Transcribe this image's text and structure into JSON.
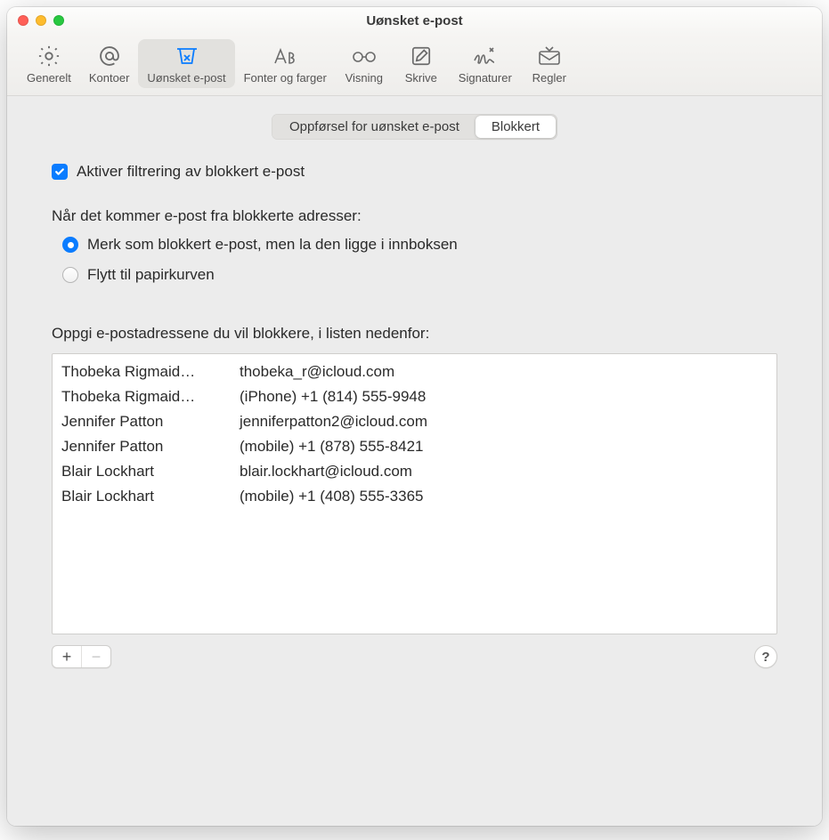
{
  "window": {
    "title": "Uønsket e-post"
  },
  "toolbar": {
    "items": [
      {
        "label": "Generelt"
      },
      {
        "label": "Kontoer"
      },
      {
        "label": "Uønsket e-post"
      },
      {
        "label": "Fonter og farger"
      },
      {
        "label": "Visning"
      },
      {
        "label": "Skrive"
      },
      {
        "label": "Signaturer"
      },
      {
        "label": "Regler"
      }
    ],
    "selected_index": 2
  },
  "segmented": {
    "items": [
      {
        "label": "Oppførsel for uønsket e-post"
      },
      {
        "label": "Blokkert"
      }
    ],
    "active_index": 1
  },
  "enable_checkbox": {
    "label": "Aktiver filtrering av blokkert e-post",
    "checked": true
  },
  "when_section": {
    "heading": "Når det kommer e-post fra blokkerte adresser:",
    "options": [
      {
        "label": "Merk som blokkert e-post, men la den ligge i innboksen"
      },
      {
        "label": "Flytt til papirkurven"
      }
    ],
    "selected_index": 0
  },
  "list_section": {
    "heading": "Oppgi e-postadressene du vil blokkere, i listen nedenfor:",
    "rows": [
      {
        "name": "Thobeka Rigmaid…",
        "value": "thobeka_r@icloud.com"
      },
      {
        "name": "Thobeka Rigmaid…",
        "value": "(iPhone) +1 (814) 555-9948"
      },
      {
        "name": "Jennifer Patton",
        "value": "jenniferpatton2@icloud.com"
      },
      {
        "name": "Jennifer Patton",
        "value": "(mobile) +1 (878) 555-8421"
      },
      {
        "name": "Blair Lockhart",
        "value": "blair.lockhart@icloud.com"
      },
      {
        "name": "Blair Lockhart",
        "value": "(mobile) +1 (408) 555-3365"
      }
    ]
  },
  "footer": {
    "add_label": "+",
    "remove_label": "−",
    "help_label": "?"
  }
}
